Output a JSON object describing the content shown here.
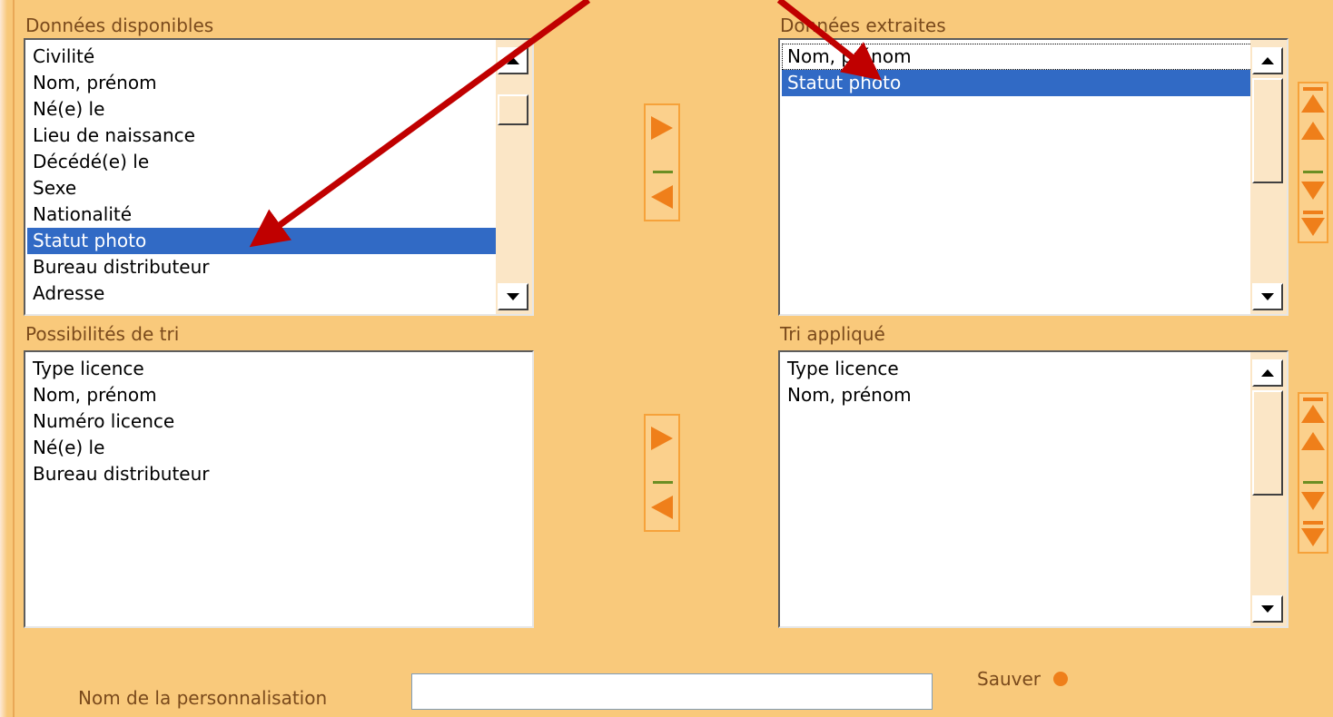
{
  "available": {
    "caption": "Données disponibles",
    "items": [
      "Civilité",
      "Nom, prénom",
      "Né(e) le",
      "Lieu de naissance",
      "Décédé(e) le",
      "Sexe",
      "Nationalité",
      "Statut photo",
      "Bureau distributeur",
      "Adresse"
    ],
    "selected_index": 7
  },
  "extracted": {
    "caption": "Données extraites",
    "items": [
      "Nom, prénom",
      "Statut photo"
    ],
    "selected_index": 1
  },
  "sort_options": {
    "caption": "Possibilités de tri",
    "items": [
      "Type licence",
      "Nom, prénom",
      "Numéro licence",
      "Né(e) le",
      "Bureau distributeur"
    ]
  },
  "sort_applied": {
    "caption": "Tri appliqué",
    "items": [
      "Type licence",
      "Nom, prénom"
    ]
  },
  "footer": {
    "name_label": "Nom de la personnalisation",
    "name_value": "",
    "save_label": "Sauver"
  },
  "colors": {
    "background": "#f9c97b",
    "accent": "#ef7f1a",
    "selection": "#316ac5",
    "annotation_arrow": "#c00000"
  },
  "icons": {
    "move_right": "triangle-right-icon",
    "move_left": "triangle-left-icon",
    "move_top": "move-to-top-icon",
    "move_up": "move-up-icon",
    "move_down": "move-down-icon",
    "move_bottom": "move-to-bottom-icon",
    "save": "orange-dot-icon"
  }
}
